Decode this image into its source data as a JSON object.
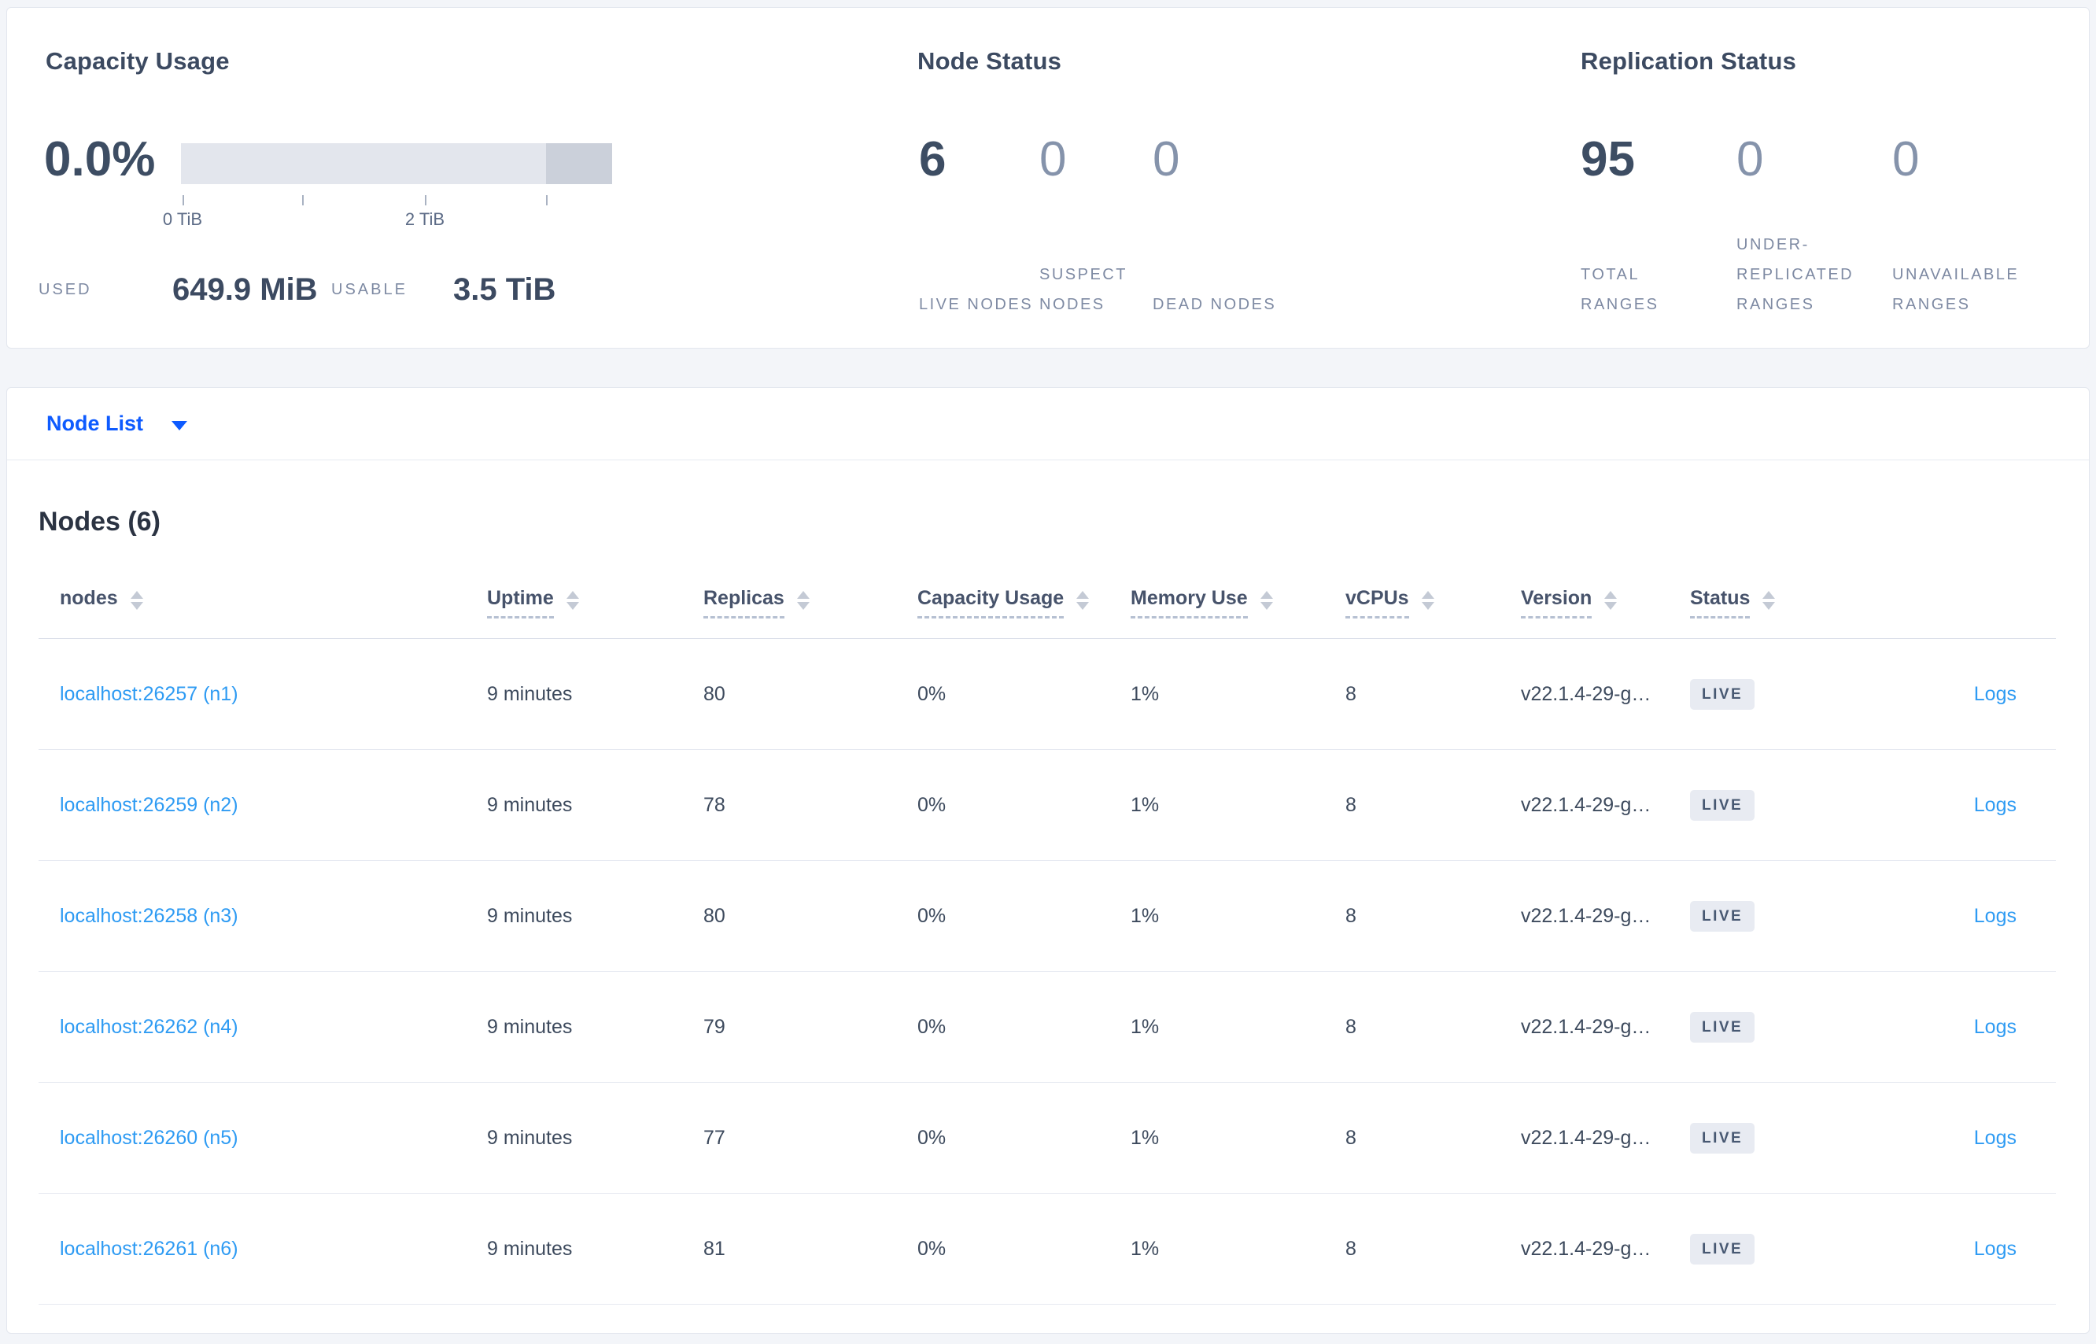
{
  "colors": {
    "link_blue": "#2e9bf3",
    "selector_blue": "#0e5bff",
    "badge_bg": "#e8ebf2",
    "badge_text": "#475872"
  },
  "capacity_card": {
    "title": "Capacity Usage",
    "percent_used": "0.0%",
    "axis_tick_labels": [
      "0 TiB",
      "2 TiB"
    ],
    "used_label": "USED",
    "used_value": "649.9 MiB",
    "usable_label": "USABLE",
    "usable_value": "3.5 TiB"
  },
  "node_status_card": {
    "title": "Node Status",
    "stats": [
      {
        "value": "6",
        "label": "LIVE NODES",
        "emphasis": true
      },
      {
        "value": "0",
        "label": "SUSPECT NODES",
        "emphasis": false
      },
      {
        "value": "0",
        "label": "DEAD NODES",
        "emphasis": false
      }
    ]
  },
  "replication_card": {
    "title": "Replication Status",
    "stats": [
      {
        "value": "95",
        "label": "TOTAL RANGES",
        "emphasis": true
      },
      {
        "value": "0",
        "label": "UNDER-REPLICATED RANGES",
        "emphasis": false
      },
      {
        "value": "0",
        "label": "UNAVAILABLE RANGES",
        "emphasis": false
      }
    ]
  },
  "node_list_selector": {
    "label": "Node List"
  },
  "nodes_section": {
    "title": "Nodes (6)",
    "table": {
      "headers": [
        {
          "label": "nodes",
          "underlined": false
        },
        {
          "label": "Uptime",
          "underlined": true
        },
        {
          "label": "Replicas",
          "underlined": true
        },
        {
          "label": "Capacity Usage",
          "underlined": true
        },
        {
          "label": "Memory Use",
          "underlined": true
        },
        {
          "label": "vCPUs",
          "underlined": true
        },
        {
          "label": "Version",
          "underlined": true
        },
        {
          "label": "Status",
          "underlined": true
        }
      ],
      "rows": [
        {
          "node": "localhost:26257 (n1)",
          "uptime": "9 minutes",
          "replicas": "80",
          "capacity": "0%",
          "memory": "1%",
          "vcpus": "8",
          "version": "v22.1.4-29-g…",
          "status": "LIVE",
          "logs": "Logs"
        },
        {
          "node": "localhost:26259 (n2)",
          "uptime": "9 minutes",
          "replicas": "78",
          "capacity": "0%",
          "memory": "1%",
          "vcpus": "8",
          "version": "v22.1.4-29-g…",
          "status": "LIVE",
          "logs": "Logs"
        },
        {
          "node": "localhost:26258 (n3)",
          "uptime": "9 minutes",
          "replicas": "80",
          "capacity": "0%",
          "memory": "1%",
          "vcpus": "8",
          "version": "v22.1.4-29-g…",
          "status": "LIVE",
          "logs": "Logs"
        },
        {
          "node": "localhost:26262 (n4)",
          "uptime": "9 minutes",
          "replicas": "79",
          "capacity": "0%",
          "memory": "1%",
          "vcpus": "8",
          "version": "v22.1.4-29-g…",
          "status": "LIVE",
          "logs": "Logs"
        },
        {
          "node": "localhost:26260 (n5)",
          "uptime": "9 minutes",
          "replicas": "77",
          "capacity": "0%",
          "memory": "1%",
          "vcpus": "8",
          "version": "v22.1.4-29-g…",
          "status": "LIVE",
          "logs": "Logs"
        },
        {
          "node": "localhost:26261 (n6)",
          "uptime": "9 minutes",
          "replicas": "81",
          "capacity": "0%",
          "memory": "1%",
          "vcpus": "8",
          "version": "v22.1.4-29-g…",
          "status": "LIVE",
          "logs": "Logs"
        }
      ]
    }
  }
}
